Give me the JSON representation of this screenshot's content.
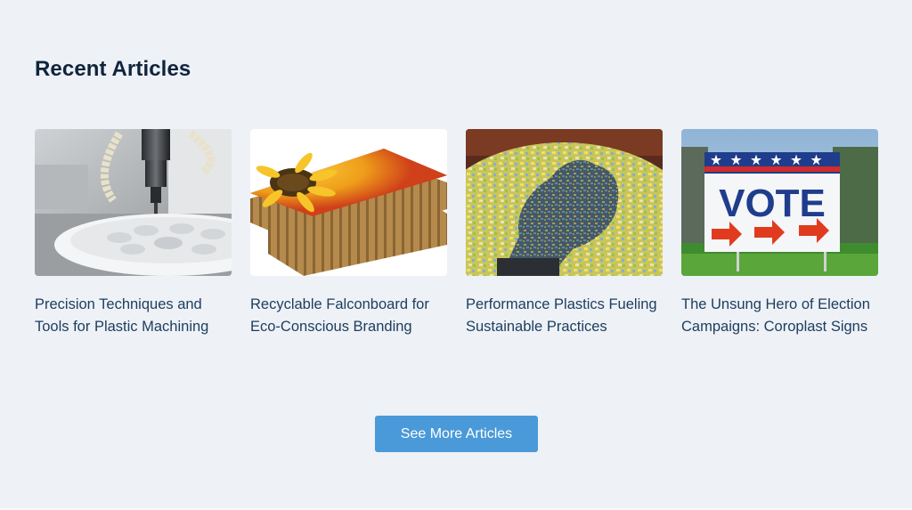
{
  "section": {
    "title": "Recent Articles"
  },
  "articles": [
    {
      "title": "Precision Techniques and Tools for Plastic Machining",
      "image_icon": "cnc-machining-image"
    },
    {
      "title": "Recyclable Falconboard for Eco-Conscious Branding",
      "image_icon": "sunflower-honeycomb-board-image"
    },
    {
      "title": "Performance Plastics Fueling Sustainable Practices",
      "image_icon": "gloved-hand-plastic-flakes-image"
    },
    {
      "title": "The Unsung Hero of Election Campaigns: Coroplast Signs",
      "image_icon": "vote-yard-sign-image",
      "sign_text": "VOTE"
    }
  ],
  "cta": {
    "label": "See More Articles"
  },
  "colors": {
    "background": "#eef1f6",
    "heading": "#10243c",
    "card_title": "#1c3d5e",
    "button": "#4a9ad9",
    "button_text": "#ffffff"
  }
}
